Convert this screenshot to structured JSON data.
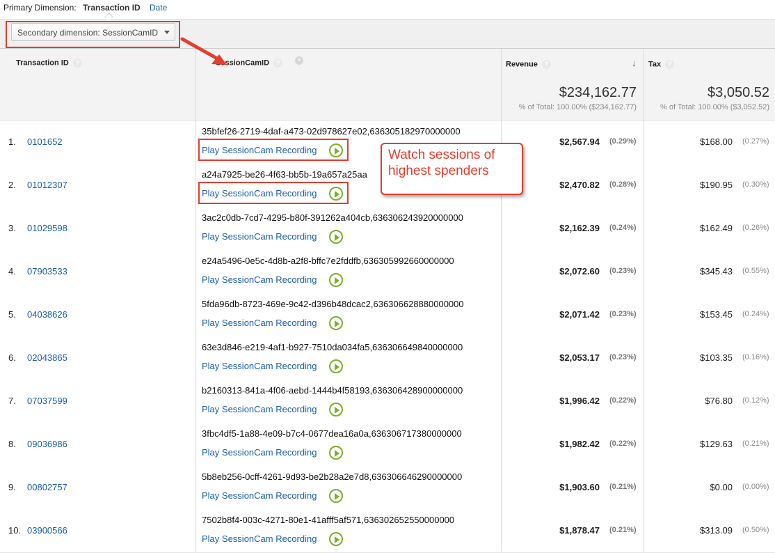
{
  "primary_dimension": {
    "label": "Primary Dimension:",
    "active": "Transaction ID",
    "other": "Date"
  },
  "secondary_dimension": {
    "label": "Secondary dimension: SessionCamID"
  },
  "columns": {
    "transaction_id": "Transaction ID",
    "sessioncam": "SessionCamID",
    "revenue": "Revenue",
    "tax": "Tax"
  },
  "totals": {
    "revenue": "$234,162.77",
    "revenue_sub": "% of Total: 100.00% ($234,162.77)",
    "tax": "$3,050.52",
    "tax_sub": "% of Total: 100.00% ($3,052.52)"
  },
  "play_label": "Play SessionCam Recording",
  "callout": {
    "line1": "Watch sessions of",
    "line2": "highest spenders"
  },
  "colors": {
    "annotation": "#e53c2d",
    "link": "#1a5ea8",
    "play_icon": "#7dae2a"
  },
  "rows": [
    {
      "idx": "1.",
      "tid": "0101652",
      "sess": "35bfef26-2719-4daf-a473-02d978627e02,636305182970000000",
      "rev": "$2,567.94",
      "revpct": "(0.29%)",
      "tax": "$168.00",
      "taxpct": "(0.27%)"
    },
    {
      "idx": "2.",
      "tid": "01012307",
      "sess": "a24a7925-be26-4f63-bb5b-19a657a25aa",
      "rev": "$2,470.82",
      "revpct": "(0.28%)",
      "tax": "$190.95",
      "taxpct": "(0.30%)"
    },
    {
      "idx": "3.",
      "tid": "01029598",
      "sess": "3ac2c0db-7cd7-4295-b80f-391262a404cb,636306243920000000",
      "rev": "$2,162.39",
      "revpct": "(0.24%)",
      "tax": "$162.49",
      "taxpct": "(0.26%)"
    },
    {
      "idx": "4.",
      "tid": "07903533",
      "sess": "e24a5496-0e5c-4d8b-a2f8-bffc7e2fddfb,636305992660000000",
      "rev": "$2,072.60",
      "revpct": "(0.23%)",
      "tax": "$345.43",
      "taxpct": "(0.55%)"
    },
    {
      "idx": "5.",
      "tid": "04038626",
      "sess": "5fda96db-8723-469e-9c42-d396b48dcac2,636306628880000000",
      "rev": "$2,071.42",
      "revpct": "(0.23%)",
      "tax": "$153.45",
      "taxpct": "(0.24%)"
    },
    {
      "idx": "6.",
      "tid": "02043865",
      "sess": "63e3d846-e219-4af1-b927-7510da034fa5,636306649840000000",
      "rev": "$2,053.17",
      "revpct": "(0.23%)",
      "tax": "$103.35",
      "taxpct": "(0.16%)"
    },
    {
      "idx": "7.",
      "tid": "07037599",
      "sess": "b2160313-841a-4f06-aebd-1444b4f58193,636306428900000000",
      "rev": "$1,996.42",
      "revpct": "(0.22%)",
      "tax": "$76.80",
      "taxpct": "(0.12%)"
    },
    {
      "idx": "8.",
      "tid": "09036986",
      "sess": "3fbc4df5-1a88-4e09-b7c4-0677dea16a0a,636306717380000000",
      "rev": "$1,982.42",
      "revpct": "(0.22%)",
      "tax": "$129.63",
      "taxpct": "(0.21%)"
    },
    {
      "idx": "9.",
      "tid": "00802757",
      "sess": "5b8eb256-0cff-4261-9d93-be2b28a2e7d8,636306646290000000",
      "rev": "$1,903.60",
      "revpct": "(0.21%)",
      "tax": "$0.00",
      "taxpct": "(0.00%)"
    },
    {
      "idx": "10.",
      "tid": "03900566",
      "sess": "7502b8f4-003c-4271-80e1-41afff5af571,636302652550000000",
      "rev": "$1,878.47",
      "revpct": "(0.21%)",
      "tax": "$313.09",
      "taxpct": "(0.50%)"
    }
  ]
}
